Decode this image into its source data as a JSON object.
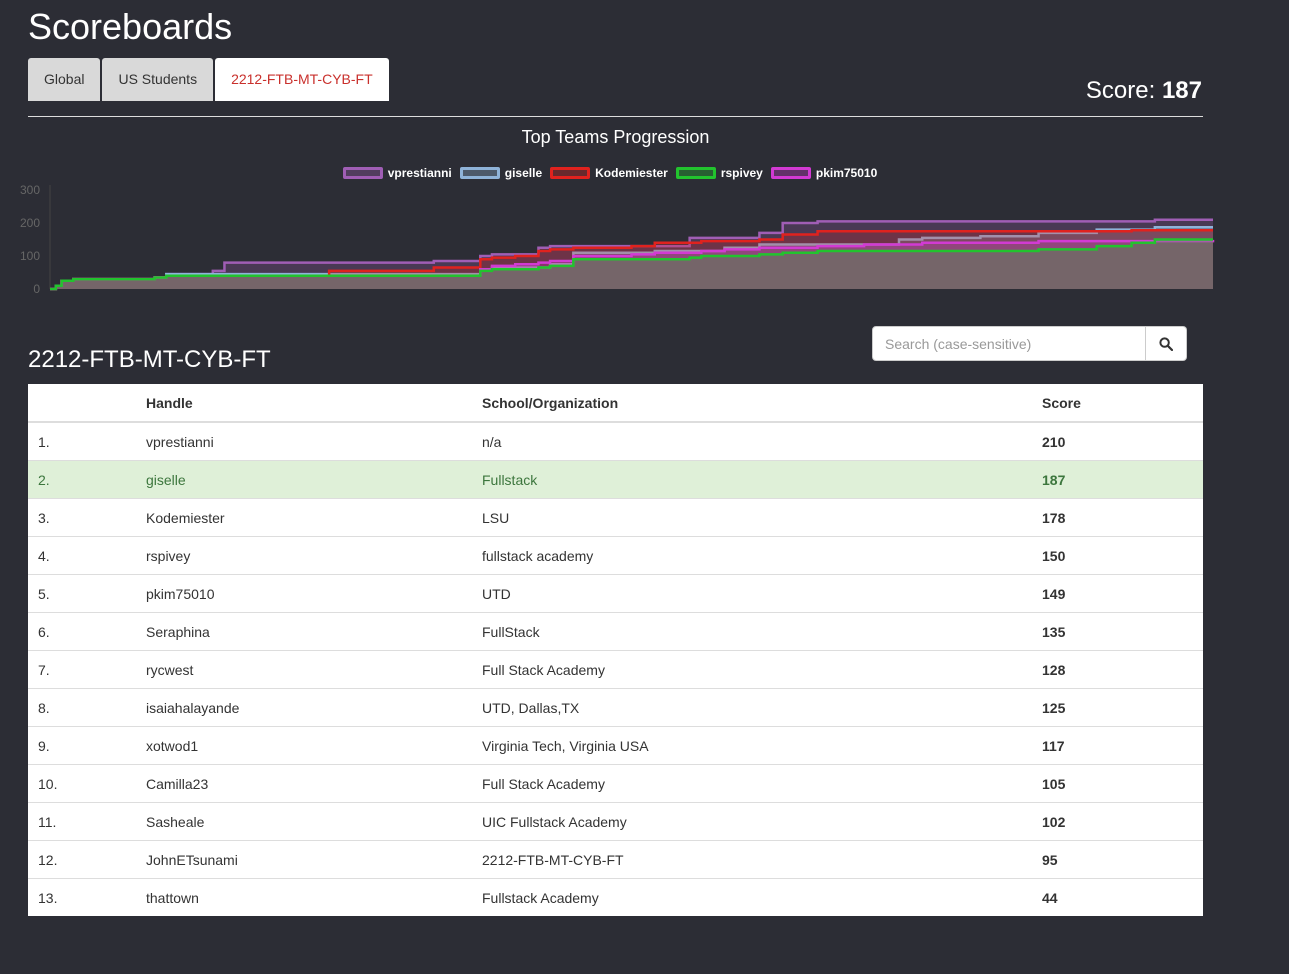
{
  "page": {
    "title": "Scoreboards"
  },
  "tabs": [
    {
      "label": "Global",
      "active": false
    },
    {
      "label": "US Students",
      "active": false
    },
    {
      "label": "2212-FTB-MT-CYB-FT",
      "active": true
    }
  ],
  "score": {
    "label": "Score:",
    "value": "187"
  },
  "section": {
    "title": "2212-FTB-MT-CYB-FT"
  },
  "search": {
    "placeholder": "Search (case-sensitive)",
    "icon": "search-icon"
  },
  "table": {
    "headers": [
      "",
      "Handle",
      "School/Organization",
      "Score"
    ],
    "rows": [
      {
        "rank": "1.",
        "handle": "vprestianni",
        "org": "n/a",
        "score": "210"
      },
      {
        "rank": "2.",
        "handle": "giselle",
        "org": "Fullstack",
        "score": "187",
        "highlight": true
      },
      {
        "rank": "3.",
        "handle": "Kodemiester",
        "org": "LSU",
        "score": "178"
      },
      {
        "rank": "4.",
        "handle": "rspivey",
        "org": "fullstack academy",
        "score": "150"
      },
      {
        "rank": "5.",
        "handle": "pkim75010",
        "org": "UTD",
        "score": "149"
      },
      {
        "rank": "6.",
        "handle": "Seraphina",
        "org": "FullStack",
        "score": "135"
      },
      {
        "rank": "7.",
        "handle": "rycwest",
        "org": "Full Stack Academy",
        "score": "128"
      },
      {
        "rank": "8.",
        "handle": "isaiahalayande",
        "org": "UTD, Dallas,TX",
        "score": "125"
      },
      {
        "rank": "9.",
        "handle": "xotwod1",
        "org": "Virginia Tech, Virginia USA",
        "score": "117"
      },
      {
        "rank": "10.",
        "handle": "Camilla23",
        "org": "Full Stack Academy",
        "score": "105"
      },
      {
        "rank": "11.",
        "handle": "Sasheale",
        "org": "UIC Fullstack Academy",
        "score": "102"
      },
      {
        "rank": "12.",
        "handle": "JohnETsunami",
        "org": "2212-FTB-MT-CYB-FT",
        "score": "95"
      },
      {
        "rank": "13.",
        "handle": "thattown",
        "org": "Fullstack Academy",
        "score": "44"
      }
    ]
  },
  "chart_data": {
    "type": "area",
    "title": "Top Teams Progression",
    "xlabel": "",
    "ylabel": "",
    "ylim": [
      0,
      300
    ],
    "yticks": [
      "0",
      "100",
      "200",
      "300"
    ],
    "grid": false,
    "legend": "top-center",
    "x": [
      0,
      0.5,
      1,
      2,
      4,
      7,
      9,
      10,
      13,
      14,
      15,
      18,
      20,
      21,
      24,
      33,
      37,
      38,
      40,
      42,
      43,
      45,
      50,
      52,
      55,
      56,
      58,
      61,
      63,
      66,
      70,
      73,
      75,
      80,
      85,
      90,
      93,
      95,
      100
    ],
    "series": [
      {
        "name": "vprestianni",
        "color": "#a05eb5",
        "values": [
          0,
          10,
          25,
          30,
          30,
          30,
          35,
          45,
          45,
          55,
          80,
          80,
          80,
          80,
          80,
          85,
          100,
          105,
          105,
          125,
          130,
          130,
          130,
          130,
          155,
          155,
          155,
          170,
          200,
          205,
          205,
          205,
          205,
          205,
          205,
          205,
          205,
          210,
          210
        ]
      },
      {
        "name": "giselle",
        "color": "#8fb3d9",
        "values": [
          0,
          10,
          25,
          30,
          30,
          30,
          35,
          45,
          45,
          45,
          45,
          45,
          45,
          45,
          45,
          45,
          60,
          65,
          65,
          65,
          75,
          110,
          110,
          115,
          115,
          115,
          125,
          135,
          135,
          135,
          135,
          150,
          155,
          160,
          170,
          180,
          180,
          187,
          187
        ]
      },
      {
        "name": "Kodemiester",
        "color": "#e0221e",
        "values": [
          0,
          10,
          25,
          30,
          30,
          30,
          35,
          40,
          40,
          40,
          40,
          40,
          40,
          40,
          55,
          65,
          90,
          95,
          100,
          115,
          120,
          125,
          130,
          140,
          140,
          145,
          145,
          150,
          165,
          175,
          175,
          175,
          175,
          175,
          175,
          175,
          178,
          178,
          178
        ]
      },
      {
        "name": "rspivey",
        "color": "#22c32e",
        "values": [
          0,
          10,
          25,
          30,
          30,
          30,
          35,
          40,
          40,
          40,
          40,
          40,
          40,
          40,
          40,
          40,
          55,
          60,
          60,
          65,
          70,
          90,
          90,
          90,
          95,
          100,
          100,
          105,
          110,
          115,
          115,
          115,
          115,
          115,
          120,
          130,
          140,
          150,
          150
        ]
      },
      {
        "name": "pkim75010",
        "color": "#d23ad3",
        "values": [
          0,
          10,
          25,
          30,
          30,
          30,
          35,
          40,
          40,
          40,
          40,
          40,
          40,
          40,
          40,
          40,
          60,
          70,
          75,
          80,
          85,
          100,
          105,
          110,
          110,
          115,
          120,
          125,
          125,
          130,
          135,
          135,
          140,
          140,
          145,
          145,
          145,
          145,
          149
        ]
      }
    ]
  }
}
